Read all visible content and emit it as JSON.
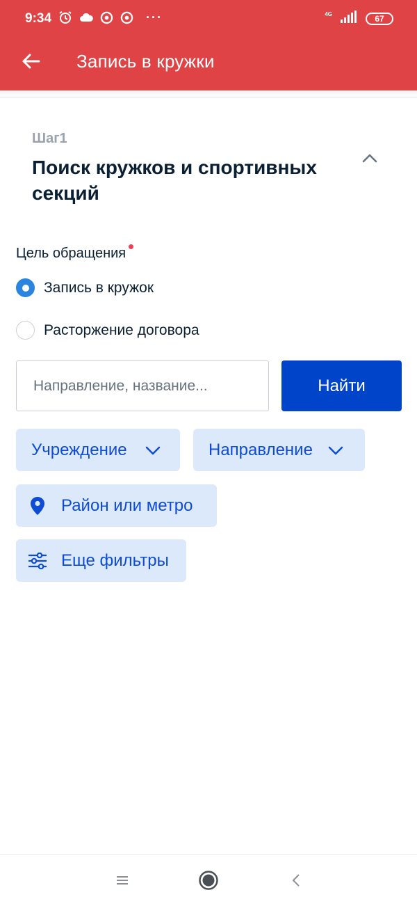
{
  "status_bar": {
    "time": "9:34",
    "network": "4G",
    "battery": "67",
    "icons": [
      "alarm-icon",
      "cloud-icon",
      "chrome-icon",
      "chrome-icon",
      "more-dots-icon",
      "signal-icon",
      "battery-icon"
    ]
  },
  "app_bar": {
    "title": "Запись в кружки",
    "back_icon": "arrow-left-icon",
    "color": "#e04345"
  },
  "step": {
    "label": "Шаг1",
    "title": "Поиск кружков и спортивных секций",
    "collapse_icon": "chevron-up-icon"
  },
  "purpose": {
    "label": "Цель обращения",
    "required": true,
    "options": [
      {
        "label": "Запись в кружок",
        "selected": true
      },
      {
        "label": "Расторжение договора",
        "selected": false
      }
    ]
  },
  "search": {
    "placeholder": "Направление, название...",
    "value": "",
    "button_label": "Найти",
    "button_color": "#0045c9"
  },
  "filters": {
    "institution": {
      "label": "Учреждение",
      "icon": "chevron-down-icon"
    },
    "direction": {
      "label": "Направление",
      "icon": "chevron-down-icon"
    },
    "location": {
      "label": "Район или метро",
      "icon": "map-pin-icon"
    },
    "more": {
      "label": "Еще фильтры",
      "icon": "sliders-icon"
    },
    "chip_color": "#dce9fb",
    "text_color": "#0d4cd3"
  },
  "nav_bar": {
    "icons": [
      "menu-icon",
      "home-icon",
      "back-chevron-icon"
    ]
  }
}
